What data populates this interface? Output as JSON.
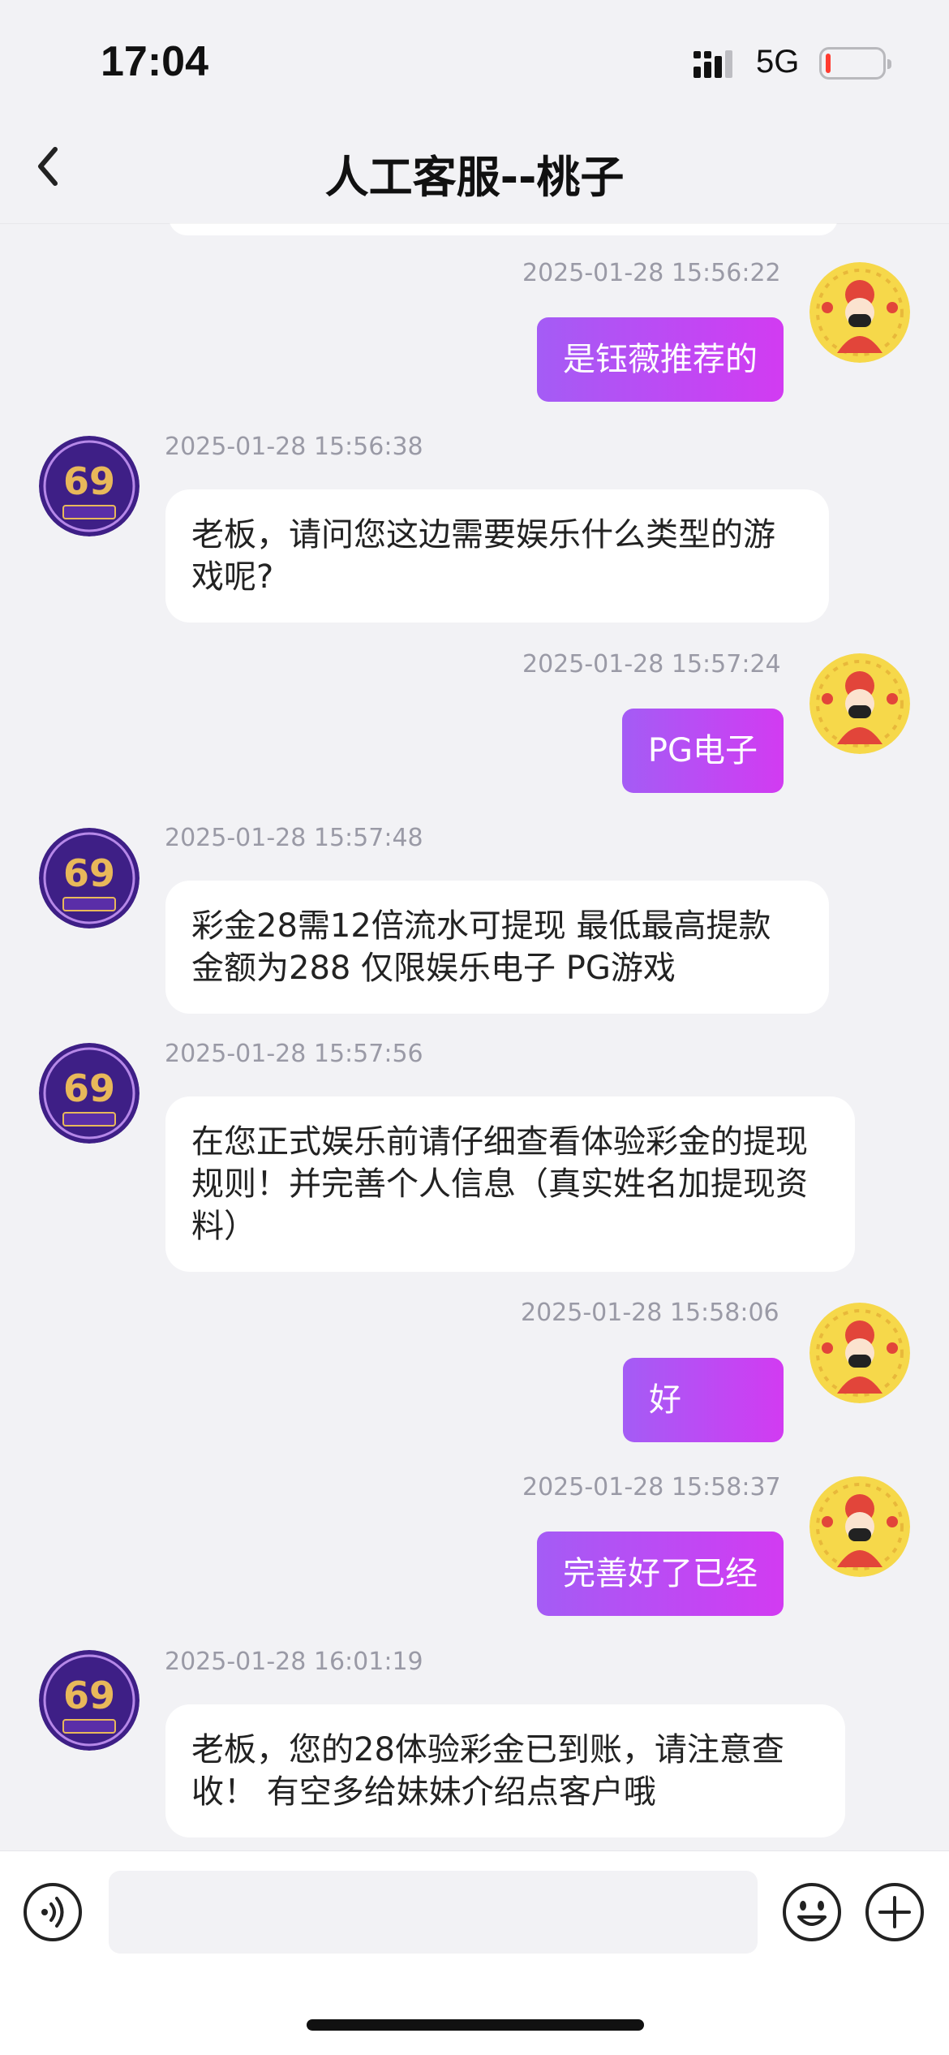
{
  "status_bar": {
    "time": "17:04",
    "network": "5G",
    "battery_level": 0.08,
    "battery_color": "#ff3b30"
  },
  "nav": {
    "title": "人工客服--桃子",
    "back_icon": "chevron-left-icon"
  },
  "colors": {
    "outgoing_gradient_start": "#a45cf5",
    "outgoing_gradient_end": "#d23bf2",
    "timestamp": "#9a9aa6",
    "background": "#f2f2f5"
  },
  "messages": [
    {
      "side": "out",
      "time": "2025-01-28 15:56:22",
      "text": "是钰薇推荐的"
    },
    {
      "side": "in",
      "time": "2025-01-28 15:56:38",
      "text": "老板，请问您这边需要娱乐什么类型的游戏呢?"
    },
    {
      "side": "out",
      "time": "2025-01-28 15:57:24",
      "text": "PG电子"
    },
    {
      "side": "in",
      "time": "2025-01-28 15:57:48",
      "text": "彩金28需12倍流水可提现 最低最高提款金额为288  仅限娱乐电子 PG游戏"
    },
    {
      "side": "in",
      "time": "2025-01-28 15:57:56",
      "text": "在您正式娱乐前请仔细查看体验彩金的提现规则！并完善个人信息（真实姓名加提现资料）"
    },
    {
      "side": "out",
      "time": "2025-01-28 15:58:06",
      "text": "好"
    },
    {
      "side": "out",
      "time": "2025-01-28 15:58:37",
      "text": "完善好了已经"
    },
    {
      "side": "in",
      "time": "2025-01-28 16:01:19",
      "text": "老板，您的28体验彩金已到账，请注意查收！ 有空多给妹妹介绍点客户哦"
    }
  ],
  "avatars": {
    "agent_icon": "agent-logo-icon",
    "user_icon": "user-avatar-icon"
  },
  "input": {
    "placeholder": "",
    "voice_icon": "voice-icon",
    "emoji_icon": "emoji-icon",
    "add_icon": "add-icon"
  }
}
